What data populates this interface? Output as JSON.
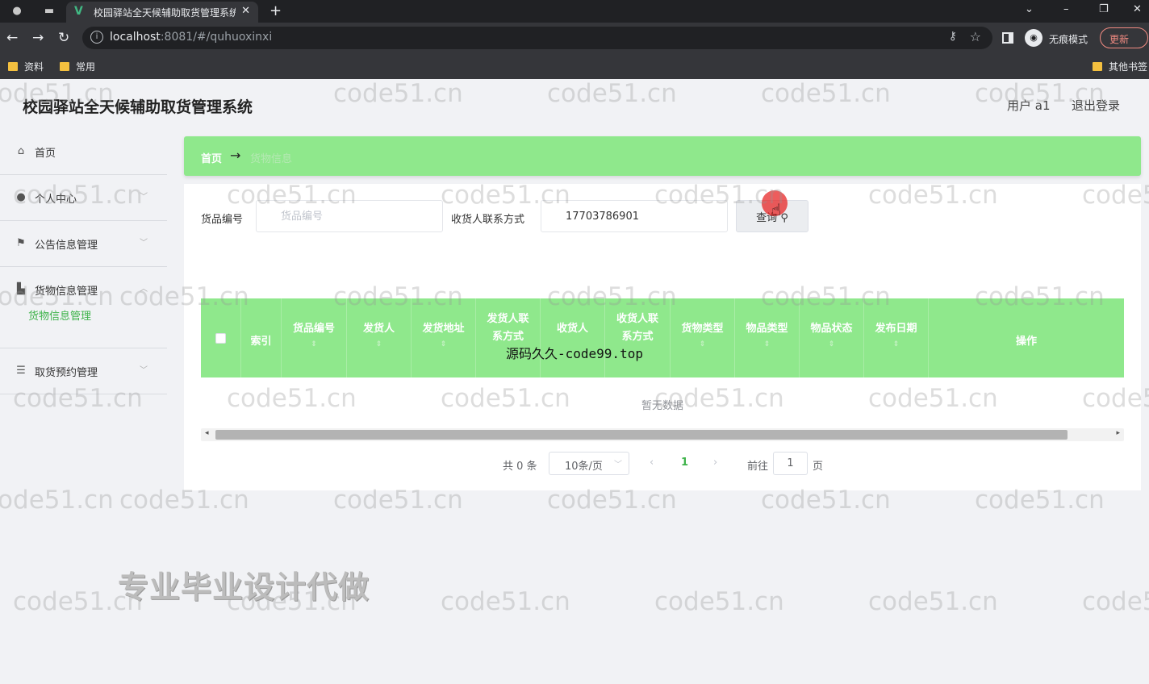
{
  "browser": {
    "tab_title": "校园驿站全天候辅助取货管理系统",
    "url_host": "localhost",
    "url_rest": ":8081/#/quhuoxinxi",
    "incognito_label": "无痕模式",
    "update_label": "更新",
    "bookmarks": [
      "资料",
      "常用"
    ],
    "other_bookmarks": "其他书签"
  },
  "app": {
    "title": "校园驿站全天候辅助取货管理系统",
    "user": "用户 a1",
    "logout": "退出登录"
  },
  "sidebar": {
    "items": [
      {
        "label": "首页",
        "icon": "home-icon"
      },
      {
        "label": "个人中心",
        "icon": "user-icon"
      },
      {
        "label": "公告信息管理",
        "icon": "flag-icon"
      },
      {
        "label": "货物信息管理",
        "icon": "chart-icon"
      },
      {
        "label": "取货预约管理",
        "icon": "list-icon"
      }
    ],
    "sub_item": "货物信息管理"
  },
  "breadcrumb": {
    "home": "首页",
    "arrow": "→",
    "current": "货物信息"
  },
  "search": {
    "goods_no_label": "货品编号",
    "goods_no_placeholder": "货品编号",
    "goods_no_value": "",
    "contact_label": "收货人联系方式",
    "contact_value": "17703786901",
    "button": "查询"
  },
  "table": {
    "columns": [
      [
        "索引"
      ],
      [
        "货品编号"
      ],
      [
        "发货人"
      ],
      [
        "发货地址"
      ],
      [
        "发货人联",
        "系方式"
      ],
      [
        "收货人"
      ],
      [
        "收货人联",
        "系方式"
      ],
      [
        "货物类型"
      ],
      [
        "物品类型"
      ],
      [
        "物品状态"
      ],
      [
        "发布日期"
      ],
      [
        "操作"
      ]
    ],
    "empty_text": "暂无数据"
  },
  "pagination": {
    "total": "共 0 条",
    "page_size": "10条/页",
    "current_page": "1",
    "goto": "前往",
    "goto_value": "1",
    "page_unit": "页"
  },
  "overlays": {
    "watermark": "code51.cn",
    "mid_text": "源码久久-code99.top",
    "big_text": "专业毕业设计代做"
  }
}
